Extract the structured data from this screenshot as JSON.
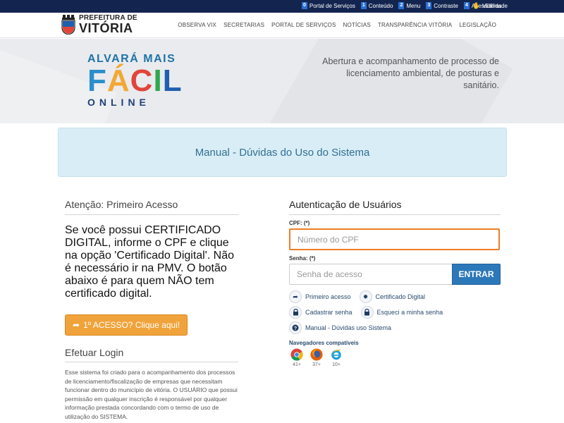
{
  "accessibility": {
    "items": [
      {
        "key": "0",
        "label": "Portal de Serviços"
      },
      {
        "key": "1",
        "label": "Conteúdo"
      },
      {
        "key": "2",
        "label": "Menu"
      },
      {
        "key": "3",
        "label": "Contraste"
      },
      {
        "key": "4",
        "label": "Acessibilidade"
      }
    ],
    "vlibras_label": "VLibras",
    "vlibras_icon": "hand-icon"
  },
  "header": {
    "logo_line1": "PREFEITURA DE",
    "logo_line2": "VITÓRIA",
    "nav": [
      "OBSERVA VIX",
      "SECRETARIAS",
      "PORTAL DE SERVIÇOS",
      "NOTÍCIAS",
      "TRANSPARÊNCIA VITÓRIA",
      "LEGISLAÇÃO"
    ]
  },
  "banner": {
    "brand_line1": "ALVARÁ MAIS",
    "brand_facil_letters": [
      "F",
      "Á",
      "C",
      "I",
      "L"
    ],
    "brand_facil_colors": [
      "#2a8ec9",
      "#f2a833",
      "#e1453a",
      "#2fa84f",
      "#1f5fae"
    ],
    "brand_line3": "ONLINE",
    "description": "Abertura e acompanhamento de processo de licenciamento ambiental, de posturas e sanitário."
  },
  "manual": {
    "title": "Manual - Dúvidas do Uso do Sistema"
  },
  "left": {
    "attention_title": "Atenção: Primeiro Acesso",
    "notice": "Se você possui CERTIFICADO DIGITAL, informe o CPF e clique na opção 'Certificado Digital'. Não é necessário ir na PMV. O botão abaixo é para quem NÃO tem certificado digital.",
    "first_access_button": "1º ACESSO? Clique aqui!",
    "login_title": "Efetuar Login",
    "login_desc": "Esse sistema foi criado para o acompanhamento dos processos de licenciamento/fiscalização de empresas que necessitam funcionar dentro do município de vitória. O USUÁRIO que possui permissão em qualquer inscrição é responsável por qualquer informação prestada concordando com o termo de uso de utilização do SISTEMA."
  },
  "auth": {
    "title": "Autenticação de Usuários",
    "cpf_label": "CPF: (*)",
    "cpf_placeholder": "Número do CPF",
    "password_label": "Senha: (*)",
    "password_placeholder": "Senha de acesso",
    "enter_button": "ENTRAR",
    "links": {
      "primeiro_acesso": "Primeiro acesso",
      "certificado_digital": "Certificado Digital",
      "cadastrar_senha": "Cadastrar senha",
      "esqueci_senha": "Esqueci a minha senha",
      "manual": "Manual - Dúvidas uso Sistema"
    },
    "browsers_title": "Navegadores compatíveis",
    "browsers": [
      {
        "name": "chrome-icon",
        "version": "41+"
      },
      {
        "name": "firefox-icon",
        "version": "37+"
      },
      {
        "name": "ie-icon",
        "version": "10+"
      }
    ]
  }
}
